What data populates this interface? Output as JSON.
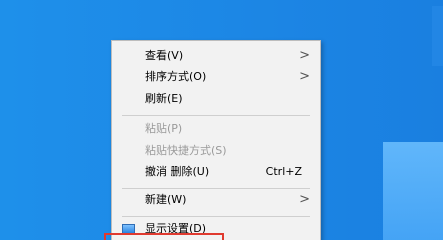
{
  "context_menu": {
    "items": [
      {
        "label": "查看(V)",
        "has_submenu": true
      },
      {
        "label": "排序方式(O)",
        "has_submenu": true
      },
      {
        "label": "刷新(E)"
      },
      {
        "label": "粘贴(P)",
        "disabled": true
      },
      {
        "label": "粘贴快捷方式(S)",
        "disabled": true
      },
      {
        "label": "撤消 删除(U)",
        "shortcut": "Ctrl+Z"
      },
      {
        "label": "新建(W)",
        "has_submenu": true
      },
      {
        "label": "显示设置(D)",
        "icon": "display-icon"
      }
    ],
    "submenu_arrow": ">"
  },
  "colors": {
    "desktop": "#1a8ae6",
    "menu_bg": "#f2f2f2",
    "highlight_border": "#e03a2f",
    "disabled_text": "#9a9a9a"
  }
}
